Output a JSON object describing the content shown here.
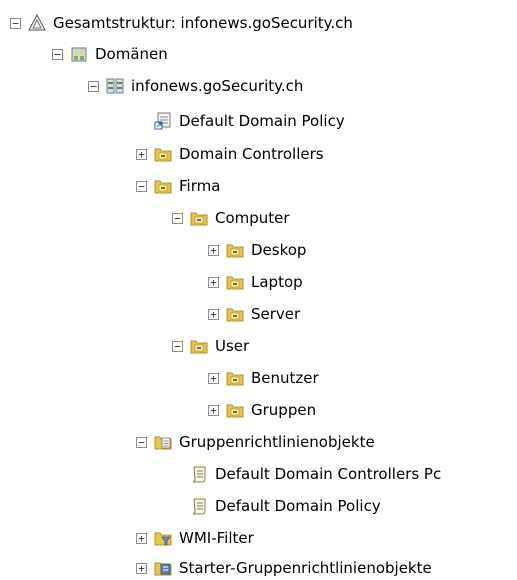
{
  "tree": {
    "forest_label": "Gesamtstruktur: infonews.goSecurity.ch",
    "domains_label": "Domänen",
    "domain_label": "infonews.goSecurity.ch",
    "default_policy_link_label": "Default Domain Policy",
    "domain_controllers_label": "Domain Controllers",
    "firma_label": "Firma",
    "computer_label": "Computer",
    "deskop_label": "Deskop",
    "laptop_label": "Laptop",
    "server_label": "Server",
    "user_label": "User",
    "benutzer_label": "Benutzer",
    "gruppen_label": "Gruppen",
    "gpo_container_label": "Gruppenrichtlinienobjekte",
    "gpo_dc_policy_label": "Default Domain Controllers Pc",
    "gpo_domain_policy_label": "Default Domain Policy",
    "wmi_filter_label": "WMI-Filter",
    "starter_gpo_label": "Starter-Gruppenrichtlinienobjekte",
    "expand_symbol": "+",
    "collapse_symbol": "−"
  },
  "colors": {
    "folder_yellow": "#e9c44a",
    "folder_dark": "#b8901d",
    "toggle_border": "#8d8d8d"
  }
}
